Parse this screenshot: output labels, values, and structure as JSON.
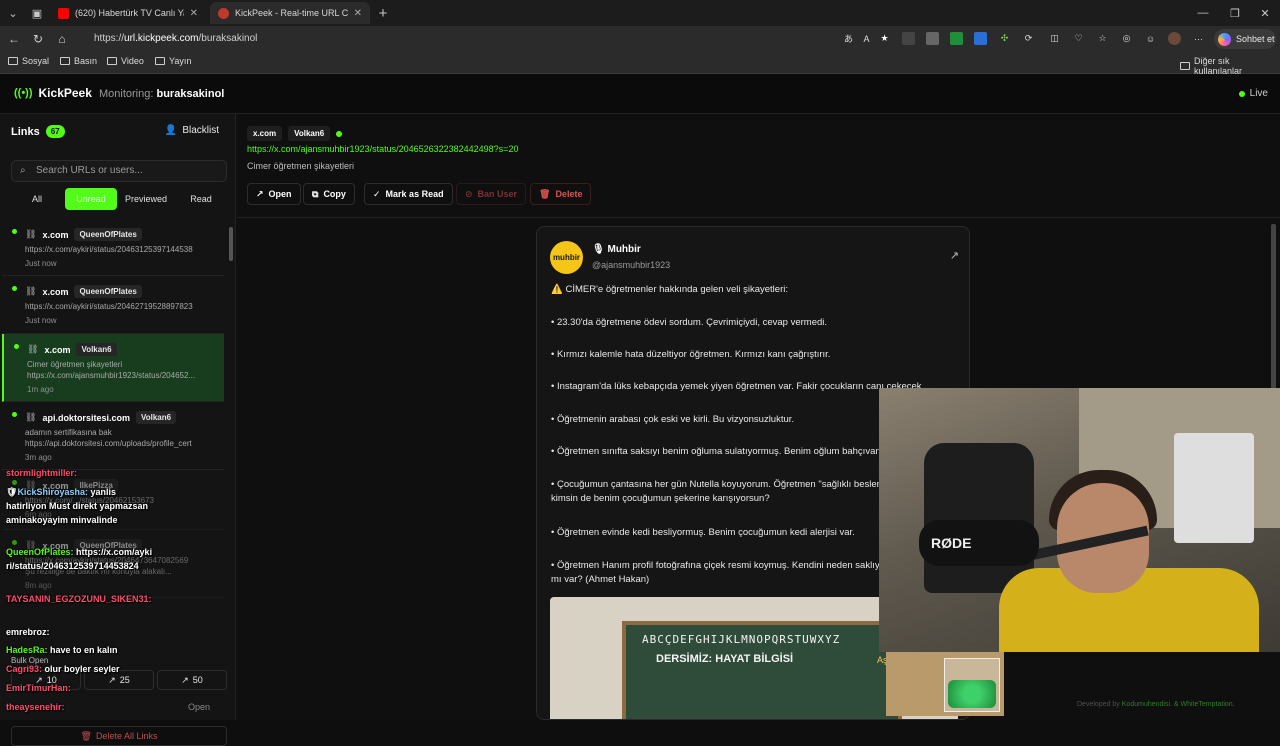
{
  "browser": {
    "tabs": [
      {
        "label": "(620) Habertürk TV Canlı Yayın ᴴᴰ",
        "favicon_color": "#ff0000"
      },
      {
        "label": "KickPeek - Real-time URL Crawler",
        "favicon_color": "#c0392b"
      }
    ],
    "new_tab": "+",
    "url_prefix": "https://",
    "url_host": "url.kickpeek.com",
    "url_path": "/buraksakinol",
    "copilot_label": "Sohbet et",
    "bookmarks": [
      "Sosyal",
      "Basın",
      "Video",
      "Yayın"
    ],
    "other_favorites": "Diğer sık kullanılanlar"
  },
  "app": {
    "brand": "KickPeek",
    "monitoring_label": "Monitoring:",
    "monitoring_user": "buraksakinol",
    "live_label": "Live",
    "accent": "#53fc18"
  },
  "sidebar": {
    "title": "Links",
    "count": "67",
    "blacklist_label": "Blacklist",
    "search_placeholder": "Search URLs or users...",
    "filters": [
      "All",
      "Unread",
      "Previewed",
      "Read"
    ],
    "items": [
      {
        "domain": "x.com",
        "user": "QueenOfPlates",
        "desc": "",
        "url": "https://x.com/aykiri/status/20463125397144538",
        "time": "Just now"
      },
      {
        "domain": "x.com",
        "user": "QueenOfPlates",
        "desc": "",
        "url": "https://x.com/aykiri/status/20462719528897823",
        "time": "Just now"
      },
      {
        "domain": "x.com",
        "user": "Volkan6",
        "desc": "Cimer öğretmen şikayetleri",
        "url": "https://x.com/ajansmuhbir1923/status/204652...",
        "time": "1m ago"
      },
      {
        "domain": "api.doktorsitesi.com",
        "user": "Volkan6",
        "desc": "adamın sertifikasına bak",
        "url": "https://api.doktorsitesi.com/uploads/profile_cert",
        "time": "3m ago"
      },
      {
        "domain": "x.com",
        "user": "IlkePizza",
        "desc": "",
        "url": "https://x.com/.../status/20462153673",
        "time": "6m ago"
      },
      {
        "domain": "x.com",
        "user": "QueenOfPlates",
        "desc": "Şu rezilliğe de baktık mı konuyla alakalı...",
        "url": "https://x.com/aykiri/status/2046473647082569",
        "time": "8m ago"
      }
    ],
    "bulk_title": "Bulk Open",
    "bulk_buttons": [
      "10",
      "25",
      "50"
    ],
    "open_label": "Open",
    "delete_all_label": "Delete All Links"
  },
  "chat": [
    {
      "user": "stormlightmiller:",
      "text": ""
    },
    {
      "user": "KickShiroyasha:",
      "text": "yanlis"
    },
    {
      "user": "",
      "text": "hatirliyon Must direkt yapmazsan"
    },
    {
      "user": "",
      "text": "aminakoyayim minvalinde"
    },
    {
      "user": "QueenOfPlates:",
      "text": "https://x.com/ayki"
    },
    {
      "user": "",
      "text": "ri/status/2046312539714453824"
    },
    {
      "user": "TAYSANIN_EGZOZUNU_SIKEN31:",
      "text": ""
    },
    {
      "user": "emrebroz:",
      "text": ""
    },
    {
      "user": "HadesRa:",
      "text": "have to en kalın"
    },
    {
      "user": "Cagri93:",
      "text": "olur boyler seyler"
    },
    {
      "user": "EmirTimurHan:",
      "text": ""
    },
    {
      "user": "theaysenehir:",
      "text": ""
    }
  ],
  "detail": {
    "domain_chip": "x.com",
    "user_chip": "Volkan6",
    "url": "https://x.com/ajansmuhbir1923/status/2046526322382442498?s=20",
    "title": "Cimer öğretmen şikayetleri",
    "actions": [
      "Open",
      "Copy",
      "Mark as Read",
      "Ban User",
      "Delete"
    ]
  },
  "tweet": {
    "avatar_text": "muhbir",
    "name": "Muhbir",
    "handle": "@ajansmuhbir1923",
    "paragraphs": [
      "⚠️ CİMER'e öğretmenler hakkında gelen veli şikayetleri:",
      "• 23.30'da öğretmene ödevi sordum. Çevrimiçiydi, cevap vermedi.",
      "• Kırmızı kalemle hata düzeltiyor öğretmen. Kırmızı kanı çağrıştırır.",
      "• Instagram'da lüks kebapçıda yemek yiyen öğretmen var. Fakir çocukların canı çekecek.",
      "• Öğretmenin arabası çok eski ve kirli. Bu vizyonsuzluktur.",
      "• Öğretmen sınıfta saksıyı benim oğluma sulatıyormuş. Benim oğlum bahçıvan mı?",
      "• Çocuğumun çantasına her gün Nutella koyuyorum. Öğretmen \"sağlıklı beslen\" demiş. Sen kimsin de benim çocuğumun şekerine karışıyorsun?",
      "• Öğretmen evinde kedi besliyormuş. Benim çocuğumun kedi alerjisi var.",
      "• Öğretmen Hanım profil fotoğrafına çiçek resmi koymuş. Kendini neden saklıyor, adli vukuatı mı var? (Ahmet Hakan)"
    ],
    "image_board_line1": "ABCÇDEFGHIJKLMNOPQRSTUWXYZ",
    "image_board_line2": "DERSİMİZ: HAYAT BİLGİSİ",
    "image_board_line3": "Aşk"
  },
  "stream": {
    "cam_brand": "RØDE",
    "credit_prefix": "Developed by",
    "credit_names": "Kodumuhendisi. & WhiteTemptation."
  }
}
